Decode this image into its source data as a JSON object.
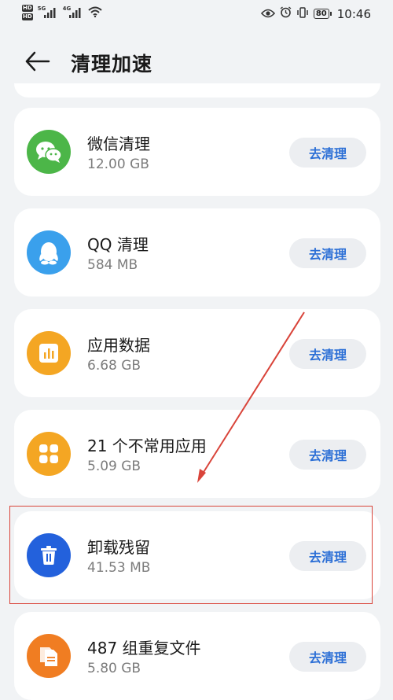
{
  "status_bar": {
    "hd1": "HD",
    "hd2": "HD",
    "sim1_tag": "5G",
    "sim2_tag": "4G",
    "battery": "80",
    "time": "10:46"
  },
  "header": {
    "title": "清理加速"
  },
  "items": [
    {
      "name": "微信清理",
      "size": "12.00 GB",
      "button": "去清理",
      "icon": "wechat-icon",
      "color": "#4cb648"
    },
    {
      "name": "QQ 清理",
      "size": "584 MB",
      "button": "去清理",
      "icon": "qq-penguin-icon",
      "color": "#3aa0ec"
    },
    {
      "name": "应用数据",
      "size": "6.68 GB",
      "button": "去清理",
      "icon": "bar-chart-icon",
      "color": "#f4a623"
    },
    {
      "name": "21 个不常用应用",
      "size": "5.09 GB",
      "button": "去清理",
      "icon": "app-grid-icon",
      "color": "#f4a623"
    },
    {
      "name": "卸载残留",
      "size": "41.53 MB",
      "button": "去清理",
      "icon": "trash-icon",
      "color": "#2361dc"
    },
    {
      "name": "487 组重复文件",
      "size": "5.80 GB",
      "button": "去清理",
      "icon": "duplicate-files-icon",
      "color": "#f07d22"
    }
  ],
  "annotation": {
    "color": "#d9443a"
  }
}
